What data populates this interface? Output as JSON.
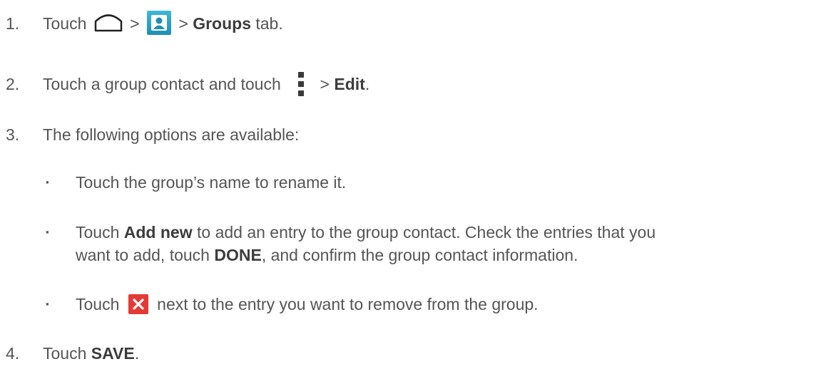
{
  "steps": [
    {
      "num": "1.",
      "parts": [
        "Touch",
        ">",
        ">",
        "Groups",
        "tab."
      ]
    },
    {
      "num": "2.",
      "parts": [
        "Touch a group contact and touch",
        "> ",
        "Edit",
        "."
      ]
    },
    {
      "num": "3.",
      "text": "The following options are available:"
    },
    {
      "num": "4.",
      "parts": [
        "Touch ",
        "SAVE",
        "."
      ]
    }
  ],
  "options": [
    {
      "bullet": "▪",
      "text": "Touch the group’s name to rename it."
    },
    {
      "bullet": "▪",
      "line1": [
        "Touch ",
        "Add new",
        " to add an entry to the group contact. Check the entries that you"
      ],
      "line2": [
        "want to add, touch ",
        "DONE",
        ", and confirm the group contact information."
      ]
    },
    {
      "bullet": "▪",
      "parts": [
        "Touch",
        "next to the entry you want to remove from the group."
      ]
    }
  ],
  "icons": {
    "home": "home-icon",
    "contacts": "contacts-icon",
    "menu": "overflow-menu-icon",
    "remove": "close-icon"
  },
  "colors": {
    "text": "#555555",
    "bold_text": "#3c3c3c",
    "contacts_icon": "#2ba3c9",
    "remove_icon": "#e53935"
  }
}
